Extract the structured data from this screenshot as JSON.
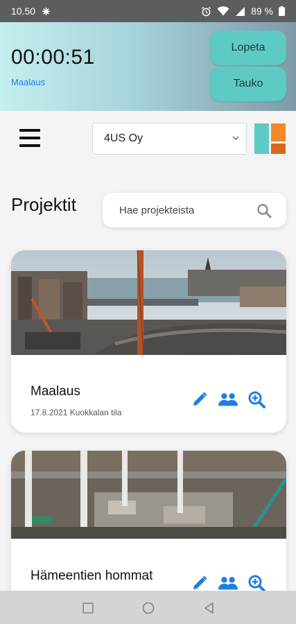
{
  "status_bar": {
    "time": "10.50",
    "battery": "89 %"
  },
  "timer": {
    "elapsed": "00:00:51",
    "project": "Maalaus",
    "stop_label": "Lopeta",
    "pause_label": "Tauko"
  },
  "toolbar": {
    "company": "4US Oy",
    "menu_icon": "hamburger-menu-icon",
    "logo_colors": [
      "#5ecac6",
      "#f4892a",
      "#d9691a"
    ]
  },
  "projects": {
    "title": "Projektit",
    "search_placeholder": "Hae projekteista",
    "items": [
      {
        "name": "Maalaus",
        "meta": "17.8.2021 Kuokkalan tila",
        "actions": [
          "edit-icon",
          "users-icon",
          "zoom-icon"
        ]
      },
      {
        "name": "Hämeentien hommat",
        "actions": [
          "edit-icon",
          "users-icon",
          "zoom-icon"
        ]
      }
    ]
  },
  "colors": {
    "accent": "#1e7ee6",
    "button": "#5ecac6"
  },
  "nav_bar": {
    "buttons": [
      "recents-square-icon",
      "home-circle-icon",
      "back-triangle-icon"
    ]
  }
}
